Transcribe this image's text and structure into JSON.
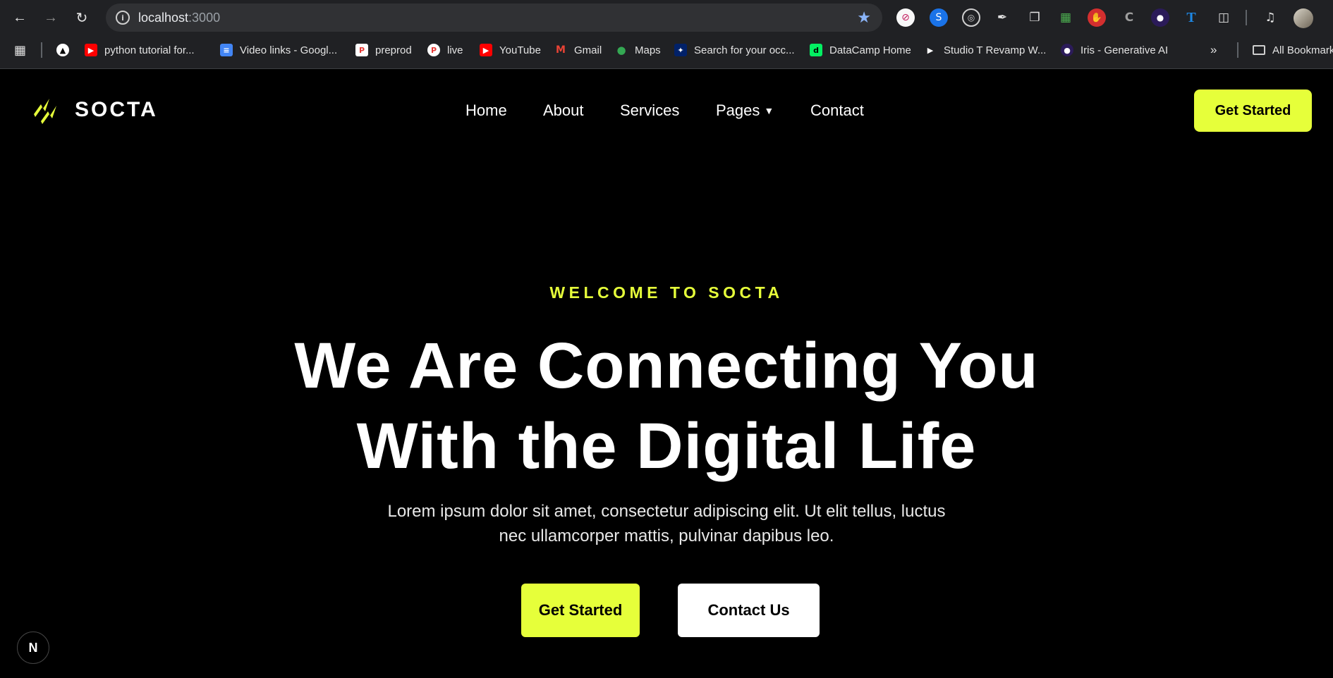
{
  "browser": {
    "url_host": "localhost",
    "url_port": ":3000",
    "bookmarks": [
      {
        "label": "python tutorial for...",
        "icon": "youtube-icon",
        "color": "#ff0000"
      },
      {
        "label": "Video links - Googl...",
        "icon": "google-docs-icon",
        "color": "#4285f4"
      },
      {
        "label": "preprod",
        "icon": "p-logo-icon",
        "color": "#ffffff"
      },
      {
        "label": "live",
        "icon": "p-logo-icon",
        "color": "#ffffff"
      },
      {
        "label": "YouTube",
        "icon": "youtube-icon",
        "color": "#ff0000"
      },
      {
        "label": "Gmail",
        "icon": "gmail-icon",
        "color": "#ea4335"
      },
      {
        "label": "Maps",
        "icon": "maps-icon",
        "color": "#34a853"
      },
      {
        "label": "Search for your occ...",
        "icon": "australia-flag-icon",
        "color": "#012169"
      },
      {
        "label": "DataCamp Home",
        "icon": "datacamp-icon",
        "color": "#03ef62"
      },
      {
        "label": "Studio T Revamp W...",
        "icon": "play-icon",
        "color": "#111111"
      },
      {
        "label": "Iris - Generative AI",
        "icon": "iris-icon",
        "color": "#2b1b59"
      }
    ],
    "all_bookmarks_label": "All Bookmarks"
  },
  "site": {
    "brand": "SOCTA",
    "accent_color": "#e6ff3a",
    "nav": [
      {
        "label": "Home"
      },
      {
        "label": "About"
      },
      {
        "label": "Services"
      },
      {
        "label": "Pages",
        "dropdown": true
      },
      {
        "label": "Contact"
      }
    ],
    "nav_cta": "Get Started",
    "hero": {
      "eyebrow": "WELCOME TO SOCTA",
      "headline_line1": "We Are Connecting You",
      "headline_line2": "With the Digital Life",
      "sub_line1": "Lorem ipsum dolor sit amet, consectetur adipiscing elit. Ut elit tellus, luctus",
      "sub_line2": "nec ullamcorper mattis, pulvinar dapibus leo.",
      "primary_cta": "Get Started",
      "secondary_cta": "Contact Us"
    },
    "dev_badge": "N"
  }
}
